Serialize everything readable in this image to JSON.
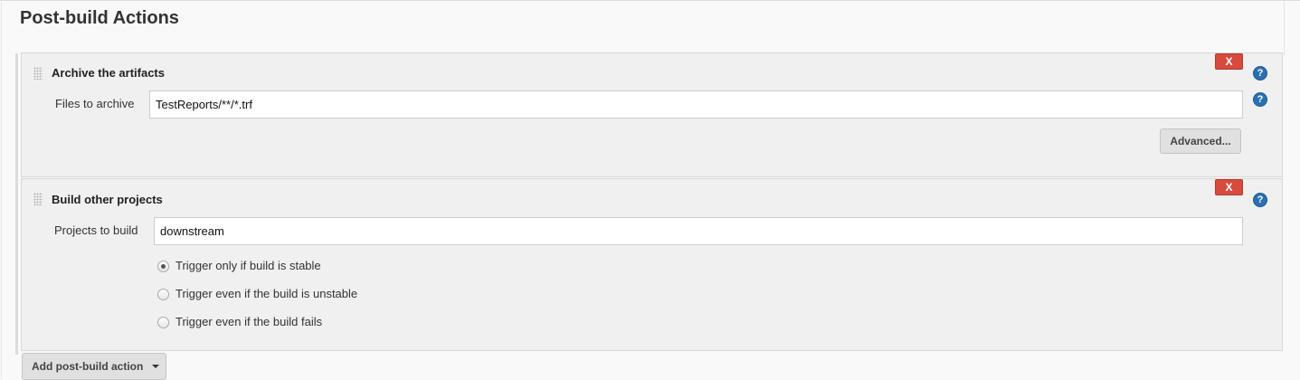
{
  "section": {
    "title": "Post-build Actions"
  },
  "archive": {
    "title": "Archive the artifacts",
    "delete_label": "X",
    "help_label": "?",
    "files_label": "Files to archive",
    "files_value": "TestReports/**/*.trf",
    "advanced_label": "Advanced..."
  },
  "build": {
    "title": "Build other projects",
    "delete_label": "X",
    "help_label": "?",
    "projects_label": "Projects to build",
    "projects_value": "downstream",
    "options": [
      {
        "label": "Trigger only if build is stable",
        "selected": true
      },
      {
        "label": "Trigger even if the build is unstable",
        "selected": false
      },
      {
        "label": "Trigger even if the build fails",
        "selected": false
      }
    ]
  },
  "add_action": {
    "label": "Add post-build action",
    "icon": "caret-down-icon"
  },
  "colors": {
    "delete": "#d64b3c",
    "help": "#2a70b3",
    "panel": "#f0f0f0"
  }
}
